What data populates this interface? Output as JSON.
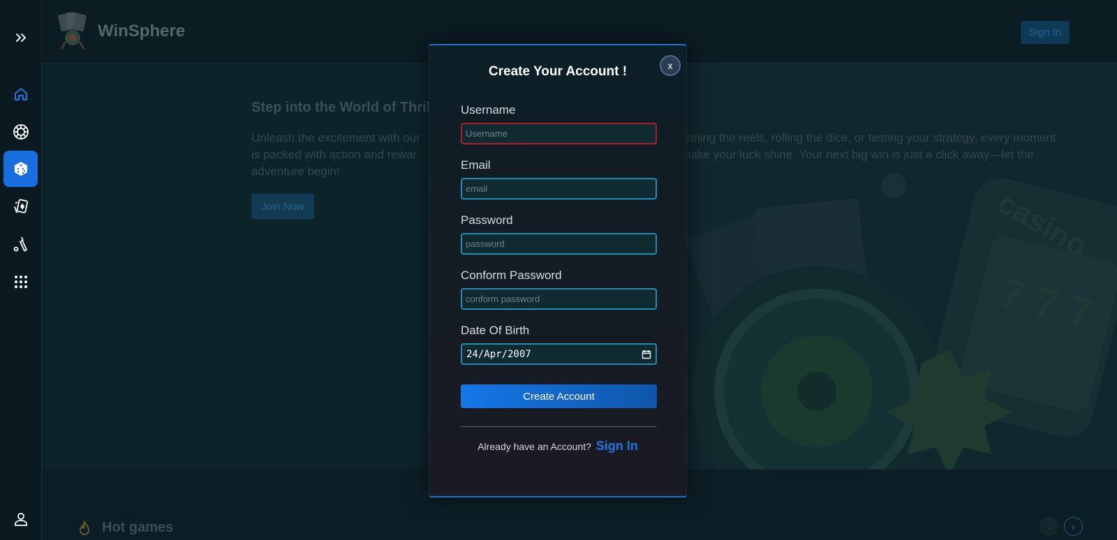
{
  "app": {
    "brand": "WinSphere",
    "header_signin": "Sign In"
  },
  "sidebar": {
    "items": [
      {
        "name": "expand",
        "icon": "double-chevron-right-icon"
      },
      {
        "name": "home",
        "icon": "home-icon"
      },
      {
        "name": "sports",
        "icon": "roulette-icon"
      },
      {
        "name": "dice",
        "icon": "dice-icon",
        "active": true
      },
      {
        "name": "cards",
        "icon": "cards-icon"
      },
      {
        "name": "cricket",
        "icon": "cricket-icon"
      },
      {
        "name": "more",
        "icon": "grid-icon"
      },
      {
        "name": "profile",
        "icon": "user-icon"
      }
    ]
  },
  "hero": {
    "title": "Step into the World of Thrill",
    "text_left": [
      "Unleash the excitement with our",
      "is packed with action and rewar",
      "adventure begin!"
    ],
    "text_right": [
      "inning the reels, rolling the dice, or testing your strategy, every moment",
      "nake your luck shine. Your next big win is just a click away—let the"
    ],
    "join_label": "Join Now"
  },
  "hot_games": {
    "title": "Hot games"
  },
  "modal": {
    "title": "Create Your Account !",
    "close_label": "x",
    "fields": {
      "username": {
        "label": "Username",
        "placeholder": "Username",
        "value": ""
      },
      "email": {
        "label": "Email",
        "placeholder": "email",
        "value": ""
      },
      "password": {
        "label": "Password",
        "placeholder": "password",
        "value": ""
      },
      "confirm": {
        "label": "Conform Password",
        "placeholder": "conform password",
        "value": ""
      },
      "dob": {
        "label": "Date Of Birth",
        "value": "24/Apr/2007"
      }
    },
    "submit_label": "Create Account",
    "signin_prompt": "Already have an Account?",
    "signin_link": "Sign In"
  },
  "colors": {
    "accent": "#1a78e6",
    "error_border": "#b11c22",
    "input_border": "#1e8fb3"
  }
}
